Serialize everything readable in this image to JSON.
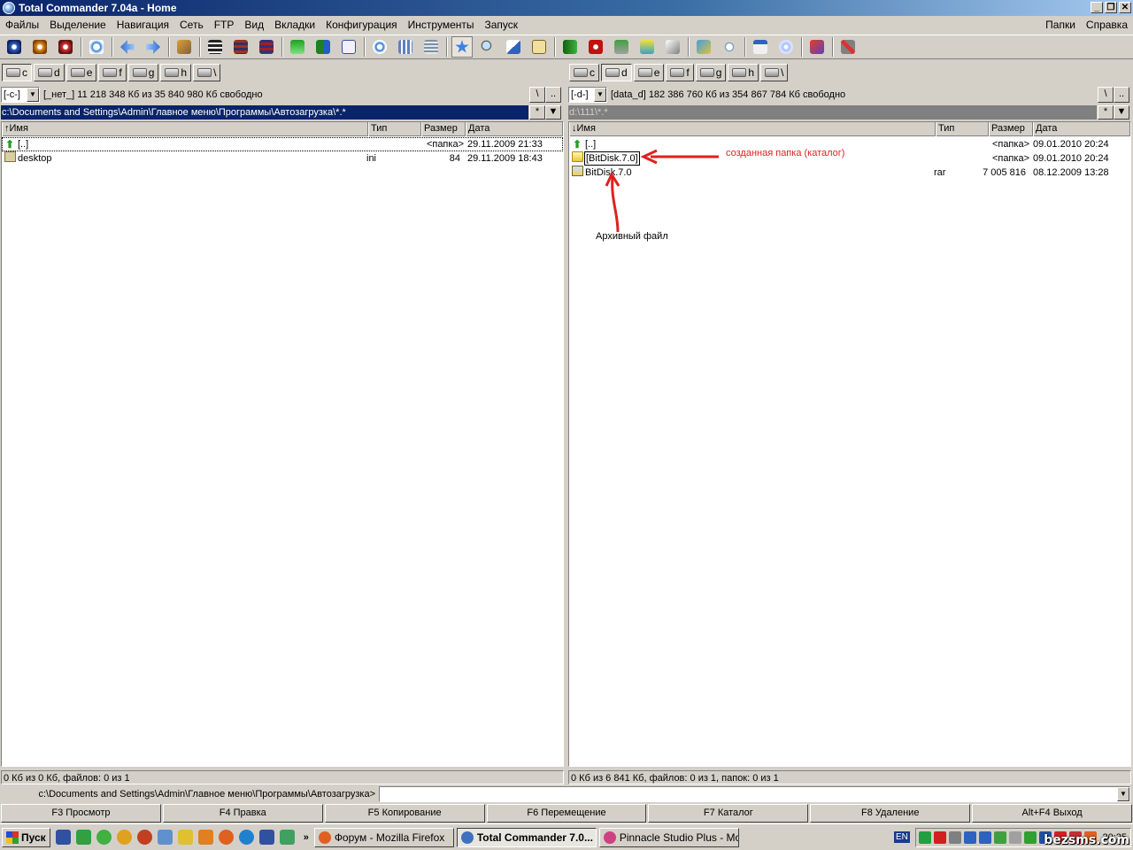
{
  "window": {
    "title": "Total Commander 7.04a - Home",
    "min": "_",
    "restore": "❐",
    "close": "✕"
  },
  "menu": {
    "items": [
      "Файлы",
      "Выделение",
      "Навигация",
      "Сеть",
      "FTP",
      "Вид",
      "Вкладки",
      "Конфигурация",
      "Инструменты",
      "Запуск"
    ],
    "right": [
      "Папки",
      "Справка"
    ]
  },
  "left": {
    "drives": [
      "c",
      "d",
      "e",
      "f",
      "g",
      "h",
      "\\"
    ],
    "drive_combo": "[-c-]",
    "free": "[_нет_]  11 218 348 Кб из 35 840 980 Кб свободно",
    "path": "c:\\Documents and Settings\\Admin\\Главное меню\\Программы\\Автозагрузка\\*.*",
    "headers": {
      "name": "↑Имя",
      "type": "Тип",
      "size": "Размер",
      "date": "Дата"
    },
    "rows": [
      {
        "name": "[..]",
        "type": "",
        "size": "<папка>",
        "date": "29.11.2009 21:33"
      },
      {
        "name": "desktop",
        "type": "ini",
        "size": "84",
        "date": "29.11.2009 18:43"
      }
    ],
    "status": "0 Кб из 0 Кб, файлов: 0 из 1"
  },
  "right": {
    "drives": [
      "c",
      "d",
      "e",
      "f",
      "g",
      "h",
      "\\"
    ],
    "drive_combo": "[-d-]",
    "free": "[data_d]  182 386 760 Кб из 354 867 784 Кб свободно",
    "path": "d:\\111\\*.*",
    "headers": {
      "name": "↓Имя",
      "type": "Тип",
      "size": "Размер",
      "date": "Дата"
    },
    "rows": [
      {
        "name": "[..]",
        "type": "",
        "size": "<папка>",
        "date": "09.01.2010 20:24"
      },
      {
        "name": "[BitDisk.7.0]",
        "type": "",
        "size": "<папка>",
        "date": "09.01.2010 20:24"
      },
      {
        "name": "BitDisk.7.0",
        "type": "rar",
        "size": "7 005 816",
        "date": "08.12.2009 13:28"
      }
    ],
    "status": "0 Кб из 6 841 Кб, файлов: 0 из 1, папок: 0 из 1"
  },
  "annotations": {
    "folder_note": "созданная папка (каталог)",
    "archive_note": "Архивный файл"
  },
  "nav": {
    "root": "\\",
    "up": "..",
    "star": "*",
    "down": "▼"
  },
  "cmdline": {
    "path": "c:\\Documents and Settings\\Admin\\Главное меню\\Программы\\Автозагрузка>"
  },
  "fkeys": [
    "F3 Просмотр",
    "F4 Правка",
    "F5 Копирование",
    "F6 Перемещение",
    "F7 Каталог",
    "F8 Удаление",
    "Alt+F4 Выход"
  ],
  "taskbar": {
    "start": "Пуск",
    "chevron": "»",
    "tasks": [
      "Форум - Mozilla Firefox",
      "Total Commander 7.0...",
      "Pinnacle Studio Plus - Mo..."
    ],
    "lang": "EN",
    "clock": "20:25"
  },
  "watermark": "bezsms.com",
  "colors": {
    "title_start": "#0a246a",
    "title_end": "#a6caf0",
    "annotation": "#e02020",
    "selection": "#0a246a"
  }
}
